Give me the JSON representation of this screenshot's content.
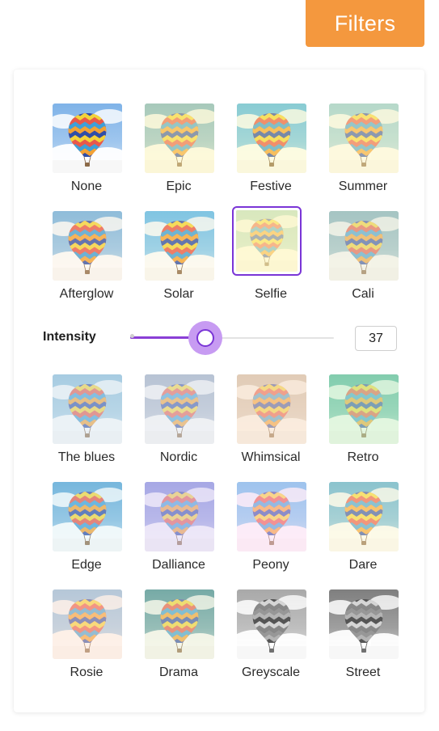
{
  "header": {
    "tab_label": "Filters"
  },
  "intensity": {
    "label": "Intensity",
    "value": "37",
    "level": 0.37
  },
  "filters_top": [
    {
      "label": "None",
      "tint": "#ffffff",
      "opacity": 0,
      "sky": "#7fb3e8",
      "gray": false,
      "selected": false
    },
    {
      "label": "Epic",
      "tint": "#fff3b0",
      "opacity": 0.45,
      "sky": "#5fa6c4",
      "gray": false,
      "selected": false
    },
    {
      "label": "Festive",
      "tint": "#fff7a8",
      "opacity": 0.35,
      "sky": "#49b4ea",
      "gray": false,
      "selected": false
    },
    {
      "label": "Summer",
      "tint": "#fff4b8",
      "opacity": 0.45,
      "sky": "#7ac2d8",
      "gray": false,
      "selected": false
    },
    {
      "label": "Afterglow",
      "tint": "#ffe6c8",
      "opacity": 0.25,
      "sky": "#6aaee0",
      "gray": false,
      "selected": false
    },
    {
      "label": "Solar",
      "tint": "#fff0c0",
      "opacity": 0.25,
      "sky": "#56b6ee",
      "gray": false,
      "selected": false
    },
    {
      "label": "Selfie",
      "tint": "#fff5b8",
      "opacity": 0.6,
      "sky": "#9ed3c6",
      "gray": false,
      "selected": true
    },
    {
      "label": "Cali",
      "tint": "#e9e6cc",
      "opacity": 0.45,
      "sky": "#6ea8bb",
      "gray": false,
      "selected": false
    }
  ],
  "filters_bottom": [
    {
      "label": "The blues",
      "tint": "#d6e4ee",
      "opacity": 0.45,
      "sky": "#7fb8d8",
      "gray": false,
      "selected": false
    },
    {
      "label": "Nordic",
      "tint": "#dfe4ea",
      "opacity": 0.5,
      "sky": "#8fa2be",
      "gray": false,
      "selected": false
    },
    {
      "label": "Whimsical",
      "tint": "#f6dcc2",
      "opacity": 0.55,
      "sky": "#c7b7a8",
      "gray": false,
      "selected": false
    },
    {
      "label": "Retro",
      "tint": "#c9f0c2",
      "opacity": 0.5,
      "sky": "#3aa99a",
      "gray": false,
      "selected": false
    },
    {
      "label": "Edge",
      "tint": "#d8eef2",
      "opacity": 0.3,
      "sky": "#4d9fd4",
      "gray": false,
      "selected": false
    },
    {
      "label": "Dalliance",
      "tint": "#ddd2f2",
      "opacity": 0.5,
      "sky": "#6f7ed8",
      "gray": false,
      "selected": false
    },
    {
      "label": "Peony",
      "tint": "#ffd8f0",
      "opacity": 0.45,
      "sky": "#4fb3ec",
      "gray": false,
      "selected": false
    },
    {
      "label": "Dare",
      "tint": "#fff6c8",
      "opacity": 0.4,
      "sky": "#3ea2d2",
      "gray": false,
      "selected": false
    },
    {
      "label": "Rosie",
      "tint": "#ffe0cc",
      "opacity": 0.45,
      "sky": "#7ab3e2",
      "gray": false,
      "selected": false
    },
    {
      "label": "Drama",
      "tint": "#e8ecc8",
      "opacity": 0.4,
      "sky": "#2b7f90",
      "gray": false,
      "selected": false
    },
    {
      "label": "Greyscale",
      "tint": "#ffffff",
      "opacity": 0,
      "sky": "#a9a9a9",
      "gray": true,
      "selected": false
    },
    {
      "label": "Street",
      "tint": "#ffffff",
      "opacity": 0,
      "sky": "#7f7f7f",
      "gray": true,
      "selected": false
    }
  ]
}
